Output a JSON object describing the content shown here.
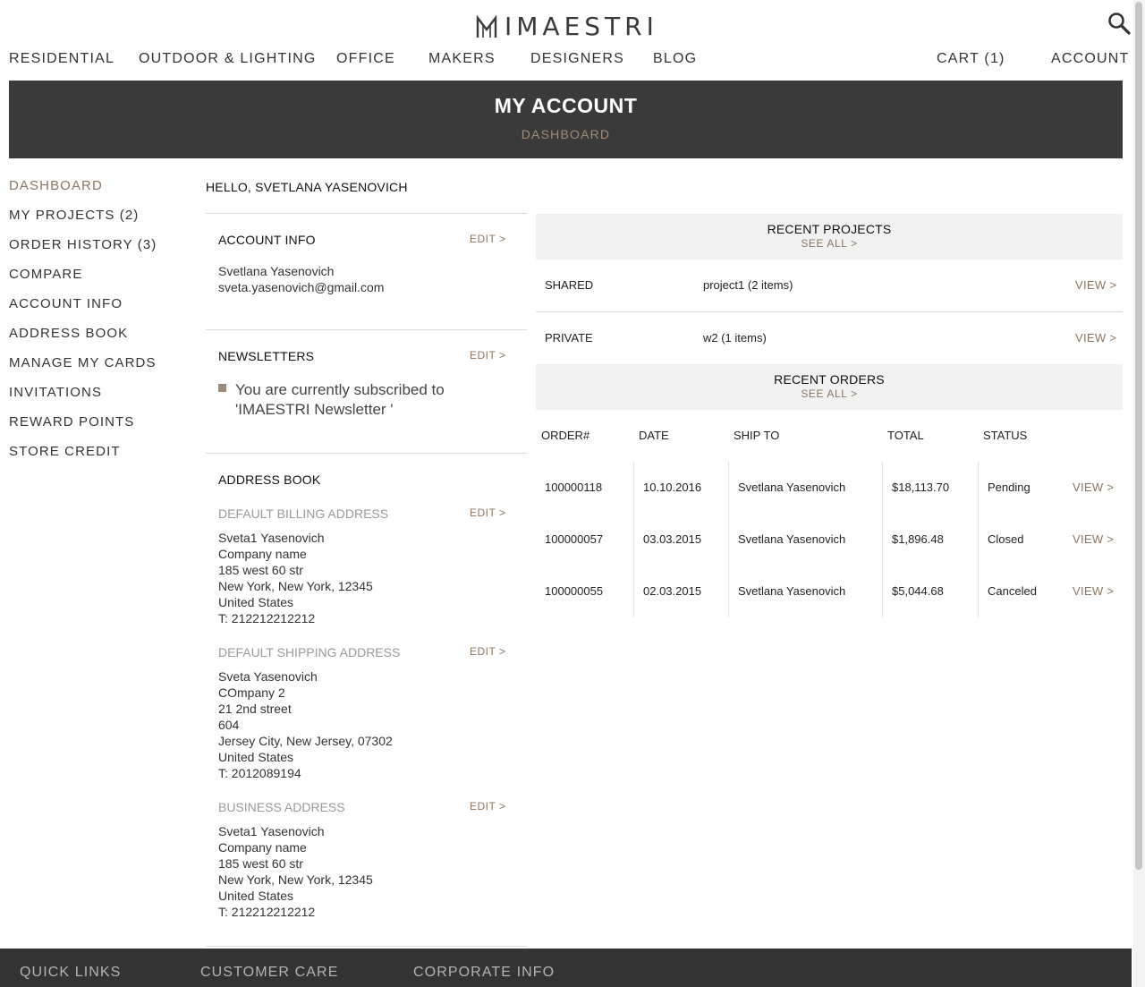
{
  "brand": "IMAESTRI",
  "nav": {
    "items": [
      "RESIDENTIAL",
      "OUTDOOR & LIGHTING",
      "OFFICE",
      "MAKERS",
      "DESIGNERS",
      "BLOG"
    ],
    "cart": "CART (1)",
    "account": "ACCOUNT"
  },
  "banner": {
    "title": "MY ACCOUNT",
    "subtitle": "DASHBOARD"
  },
  "sidebar": {
    "items": [
      "DASHBOARD",
      "MY PROJECTS (2)",
      "ORDER HISTORY (3)",
      "COMPARE",
      "ACCOUNT INFO",
      "ADDRESS BOOK",
      "MANAGE MY CARDS",
      "INVITATIONS",
      "REWARD POINTS",
      "STORE CREDIT"
    ]
  },
  "greeting": "HELLO, SVETLANA YASENOVICH",
  "edit_label": "EDIT >",
  "account_info": {
    "title": "ACCOUNT INFO",
    "name": "Svetlana Yasenovich",
    "email": "sveta.yasenovich@gmail.com"
  },
  "newsletters": {
    "title": "NEWSLETTERS",
    "text": "You are currently subscribed to 'IMAESTRI Newsletter '"
  },
  "address_book": {
    "title": "ADDRESS BOOK",
    "billing": {
      "title": "DEFAULT BILLING ADDRESS",
      "lines": [
        "Sveta1 Yasenovich",
        "Company name",
        "185 west 60 str",
        "New York, New York, 12345",
        "United States",
        "T: 212212212212"
      ]
    },
    "shipping": {
      "title": "DEFAULT SHIPPING ADDRESS",
      "lines": [
        "Sveta Yasenovich",
        "COmpany 2",
        "21 2nd street",
        "604",
        "Jersey City, New Jersey, 07302",
        "United States",
        "T: 2012089194"
      ]
    },
    "business": {
      "title": "BUSINESS ADDRESS",
      "lines": [
        "Sveta1 Yasenovich",
        "Company name",
        "185 west 60 str",
        "New York, New York, 12345",
        "United States",
        "T: 212212212212"
      ]
    }
  },
  "recent_projects": {
    "title": "RECENT PROJECTS",
    "see_all": "SEE ALL >",
    "rows": [
      {
        "type": "SHARED",
        "name": "project1 (2 items)",
        "action": "VIEW >"
      },
      {
        "type": "PRIVATE",
        "name": "w2 (1 items)",
        "action": "VIEW >"
      }
    ]
  },
  "recent_orders": {
    "title": "RECENT ORDERS",
    "see_all": "SEE ALL >",
    "columns": [
      "ORDER#",
      "DATE",
      "SHIP TO",
      "TOTAL",
      "STATUS"
    ],
    "rows": [
      {
        "order": "100000118",
        "date": "10.10.2016",
        "ship_to": "Svetlana Yasenovich",
        "total": "$18,113.70",
        "status": "Pending",
        "action": "VIEW >"
      },
      {
        "order": "100000057",
        "date": "03.03.2015",
        "ship_to": "Svetlana Yasenovich",
        "total": "$1,896.48",
        "status": "Closed",
        "action": "VIEW >"
      },
      {
        "order": "100000055",
        "date": "02.03.2015",
        "ship_to": "Svetlana Yasenovich",
        "total": "$5,044.68",
        "status": "Canceled",
        "action": "VIEW >"
      }
    ]
  },
  "footer": {
    "items": [
      "QUICK LINKS",
      "CUSTOMER CARE",
      "CORPORATE INFO"
    ]
  },
  "colors": {
    "accent": "#8c7560",
    "banner": "#3a3a3a",
    "band": "#f1f1f1"
  }
}
